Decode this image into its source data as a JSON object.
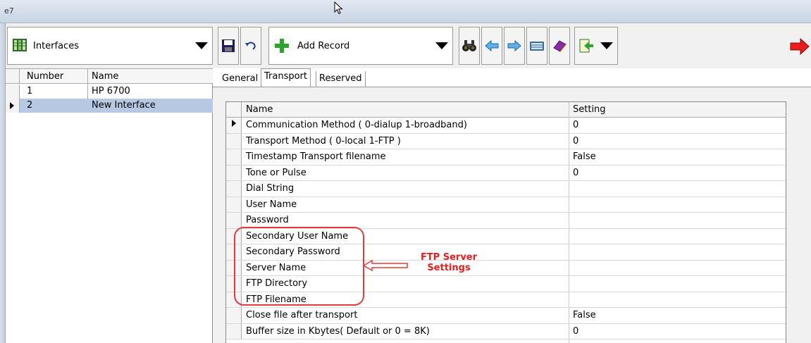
{
  "window": {
    "title": "e7"
  },
  "toolbar": {
    "table_select": "Interfaces",
    "add_record": "Add Record",
    "icons": [
      "save-icon",
      "undo-icon",
      "add-record-icon",
      "binoculars-icon",
      "back-arrow-icon",
      "forward-arrow-icon",
      "keyboard-icon",
      "book-icon",
      "export-icon",
      "exit-arrow-icon"
    ]
  },
  "left_grid": {
    "columns": [
      "Number",
      "Name"
    ],
    "rows": [
      {
        "number": "1",
        "name": "HP 6700"
      },
      {
        "number": "2",
        "name": "New Interface"
      }
    ]
  },
  "tabs": [
    "General",
    "Transport",
    "Reserved"
  ],
  "settings_grid": {
    "columns": [
      "Name",
      "Setting"
    ],
    "rows": [
      {
        "name": "Communication Method ( 0-dialup 1-broadband)",
        "value": "0"
      },
      {
        "name": "Transport Method ( 0-local 1-FTP )",
        "value": "0"
      },
      {
        "name": "Timestamp Transport filename",
        "value": "False"
      },
      {
        "name": "Tone or Pulse",
        "value": "0"
      },
      {
        "name": "Dial String",
        "value": ""
      },
      {
        "name": "User Name",
        "value": ""
      },
      {
        "name": "Password",
        "value": ""
      },
      {
        "name": "Secondary User Name",
        "value": ""
      },
      {
        "name": "Secondary Password",
        "value": ""
      },
      {
        "name": "Server Name",
        "value": ""
      },
      {
        "name": "FTP Directory",
        "value": ""
      },
      {
        "name": "FTP Filename",
        "value": ""
      },
      {
        "name": "Close file after transport",
        "value": "False"
      },
      {
        "name": "Buffer size in Kbytes( Default or 0 = 8K)",
        "value": "0"
      }
    ]
  },
  "annotation": {
    "line1": "FTP Server",
    "line2": "Settings",
    "color": "#e52020"
  }
}
